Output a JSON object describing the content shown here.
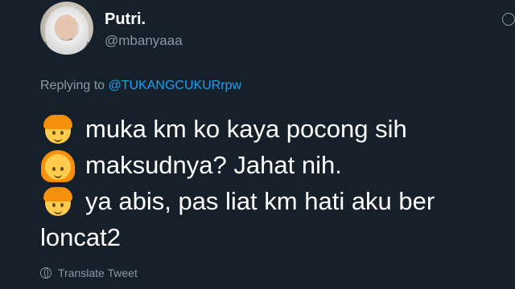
{
  "author": {
    "display_name": "Putri.",
    "handle": "@mbanyaaa"
  },
  "reply_context": {
    "prefix": "Replying to",
    "mention": "@TUKANGCUKURrpw"
  },
  "tweet_lines": [
    {
      "emoji": "boy-emoji",
      "text": "muka km ko kaya pocong sih"
    },
    {
      "emoji": "girl-emoji",
      "text": "maksudnya? Jahat nih."
    },
    {
      "emoji": "boy-emoji",
      "text": "ya abis, pas liat km hati aku ber"
    },
    {
      "emoji": "",
      "text": "loncat2"
    }
  ],
  "translate_label": "Translate Tweet",
  "colors": {
    "background": "#15202b",
    "secondary_text": "#8899a6",
    "link": "#1da1f2"
  }
}
